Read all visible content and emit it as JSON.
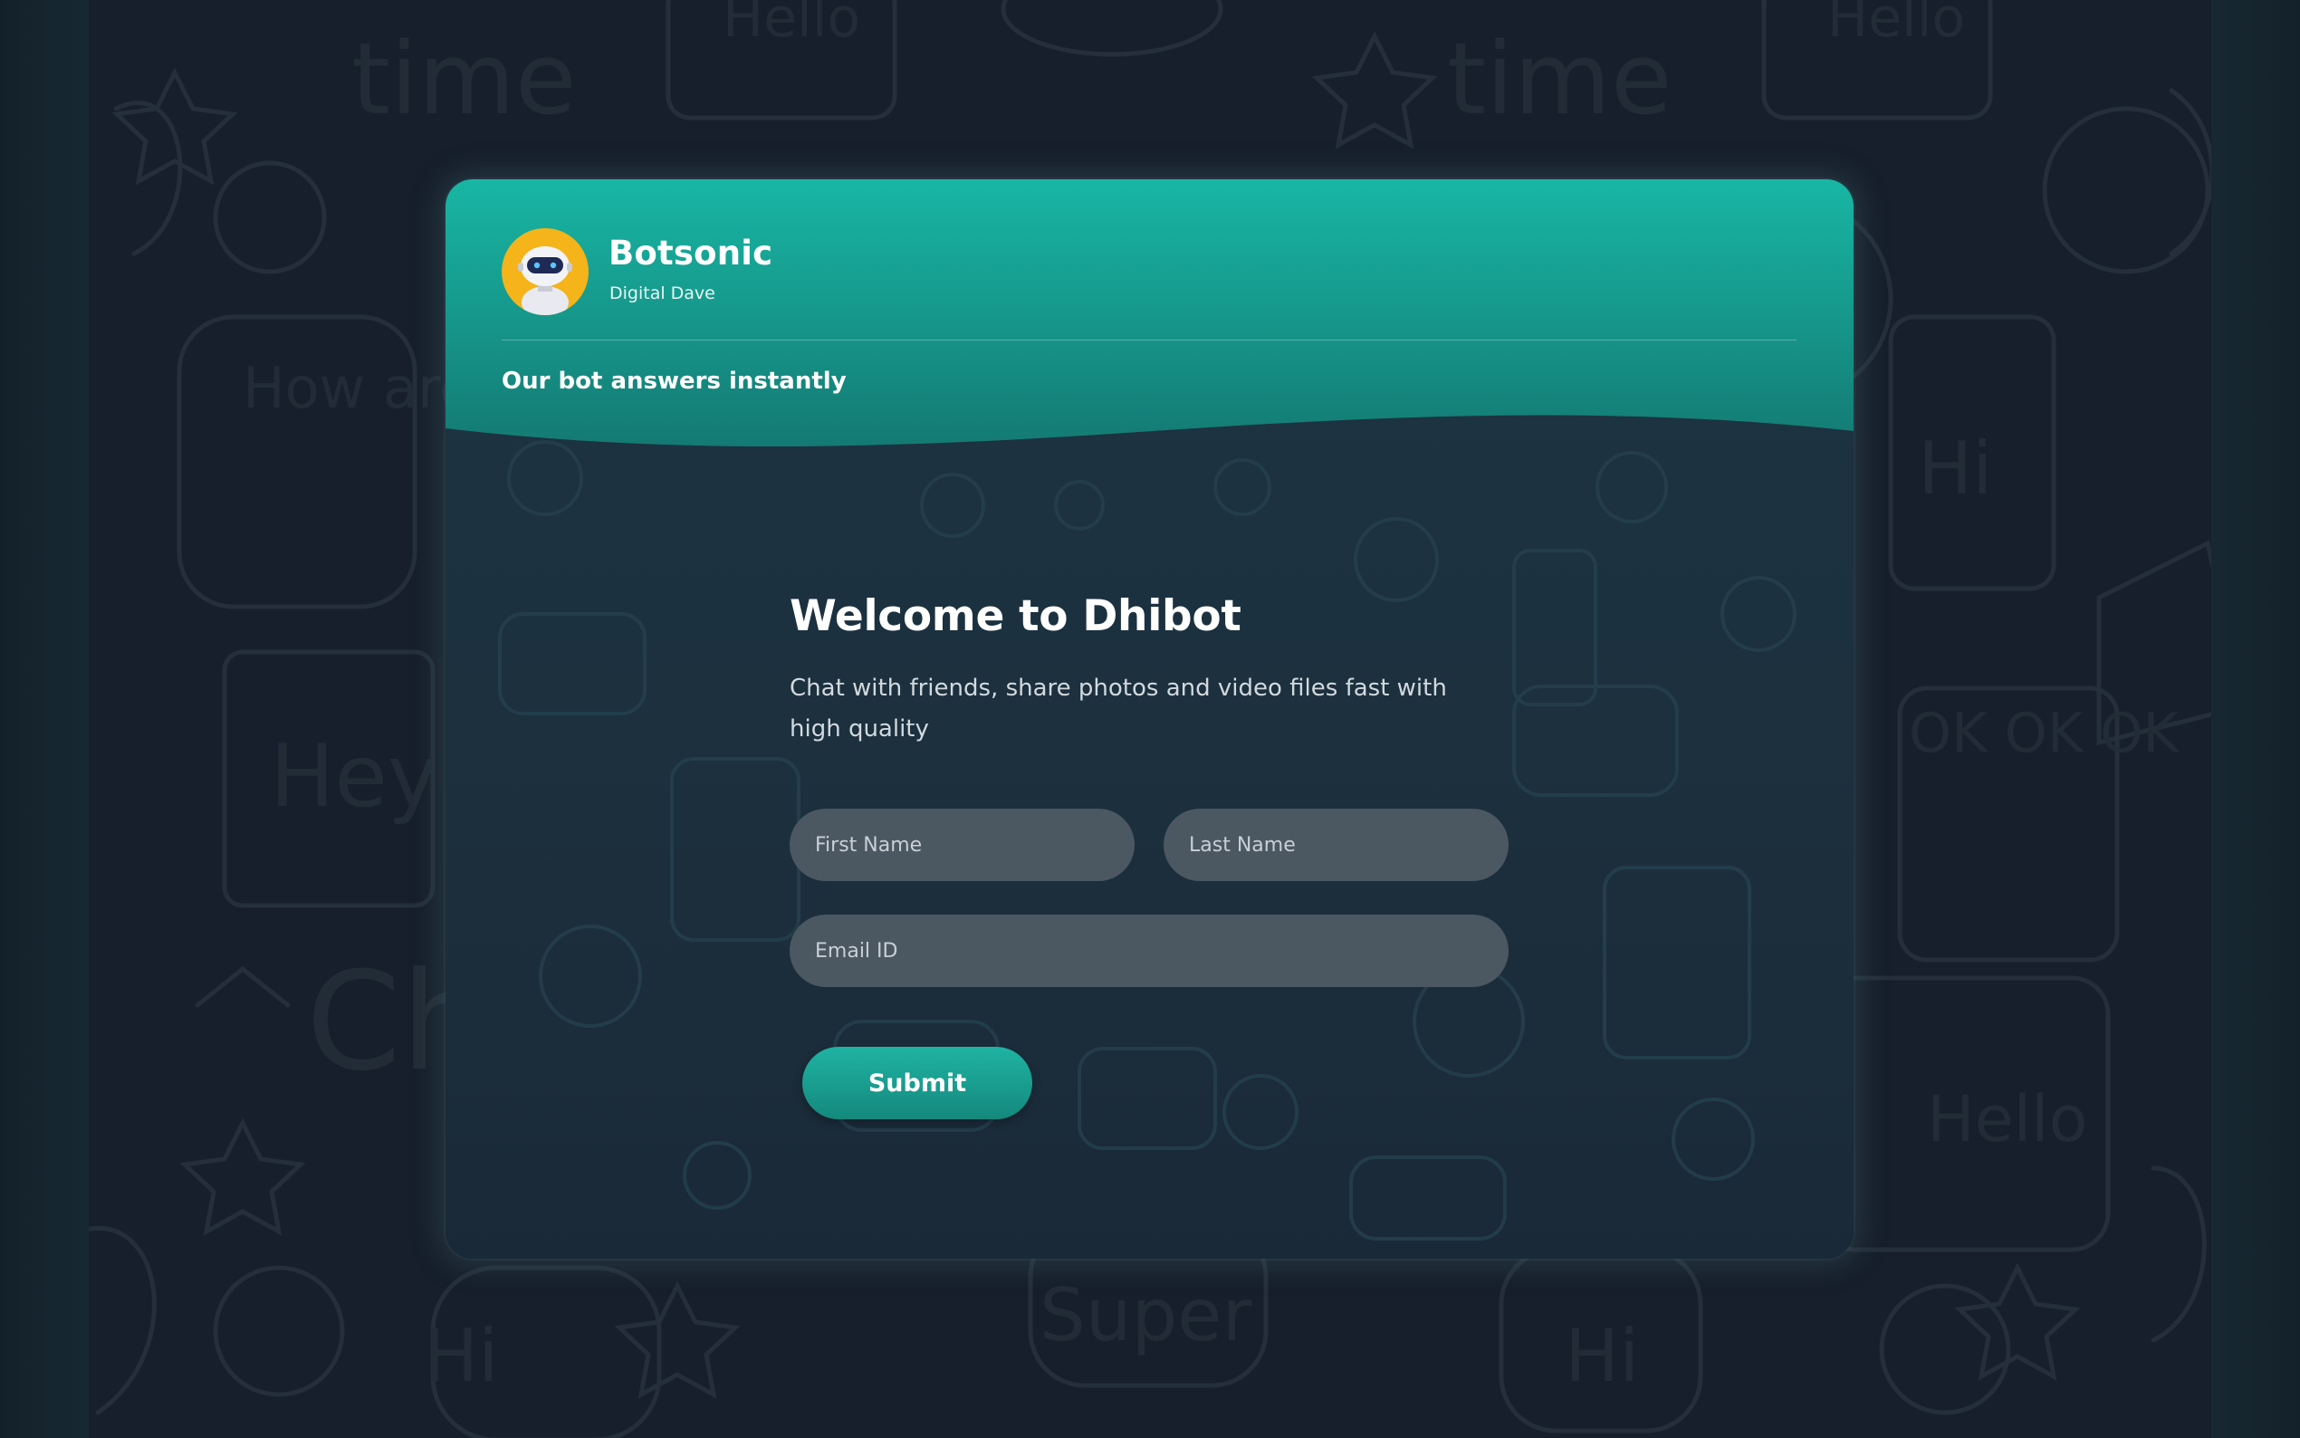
{
  "colors": {
    "header_top": "#18b6a4",
    "header_bottom": "#147a73",
    "card_body": "#1d3543",
    "page_background": "#161f2b",
    "avatar_background": "#f4b41a",
    "input_background": "#4b5862",
    "submit_button": "#1aa594"
  },
  "background": {
    "doodle_words": [
      "time",
      "Hello",
      "Hi",
      "How are U ?",
      "Hey",
      "OK OK OK",
      "Super",
      "Ch"
    ]
  },
  "header": {
    "avatar_icon": "robot-icon",
    "bot_name": "Botsonic",
    "bot_subtitle": "Digital Dave",
    "tagline": "Our bot answers instantly"
  },
  "welcome": {
    "title": "Welcome to Dhibot",
    "text": "Chat with friends, share photos and video files fast with high quality"
  },
  "form": {
    "first_name_placeholder": "First Name",
    "last_name_placeholder": "Last Name",
    "email_placeholder": "Email ID",
    "submit_label": "Submit"
  }
}
